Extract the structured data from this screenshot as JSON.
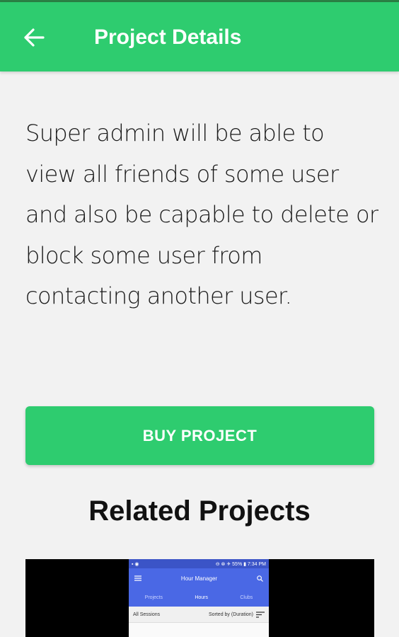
{
  "appbar": {
    "title": "Project Details",
    "back_icon": "arrow-left-icon",
    "color": "#2ecc6f"
  },
  "description": "Super admin will be able to view all friends of some user and also be capable to delete or block some user from contacting another user.",
  "buy_button": {
    "label": "BUY PROJECT"
  },
  "related": {
    "heading": "Related Projects",
    "thumbnail": {
      "status_left": "▪ ◉",
      "status_right": "⊖ ⊗ ✈ 55% ▮ 7:34 PM",
      "app_title": "Hour Manager",
      "menu_icon": "menu-icon",
      "search_icon": "search-icon",
      "tabs": [
        "Projects",
        "Hours",
        "Clubs"
      ],
      "list_label": "All Sessions",
      "sort_label": "Sorted by (Duration)",
      "sort_icon": "sort-icon"
    }
  }
}
